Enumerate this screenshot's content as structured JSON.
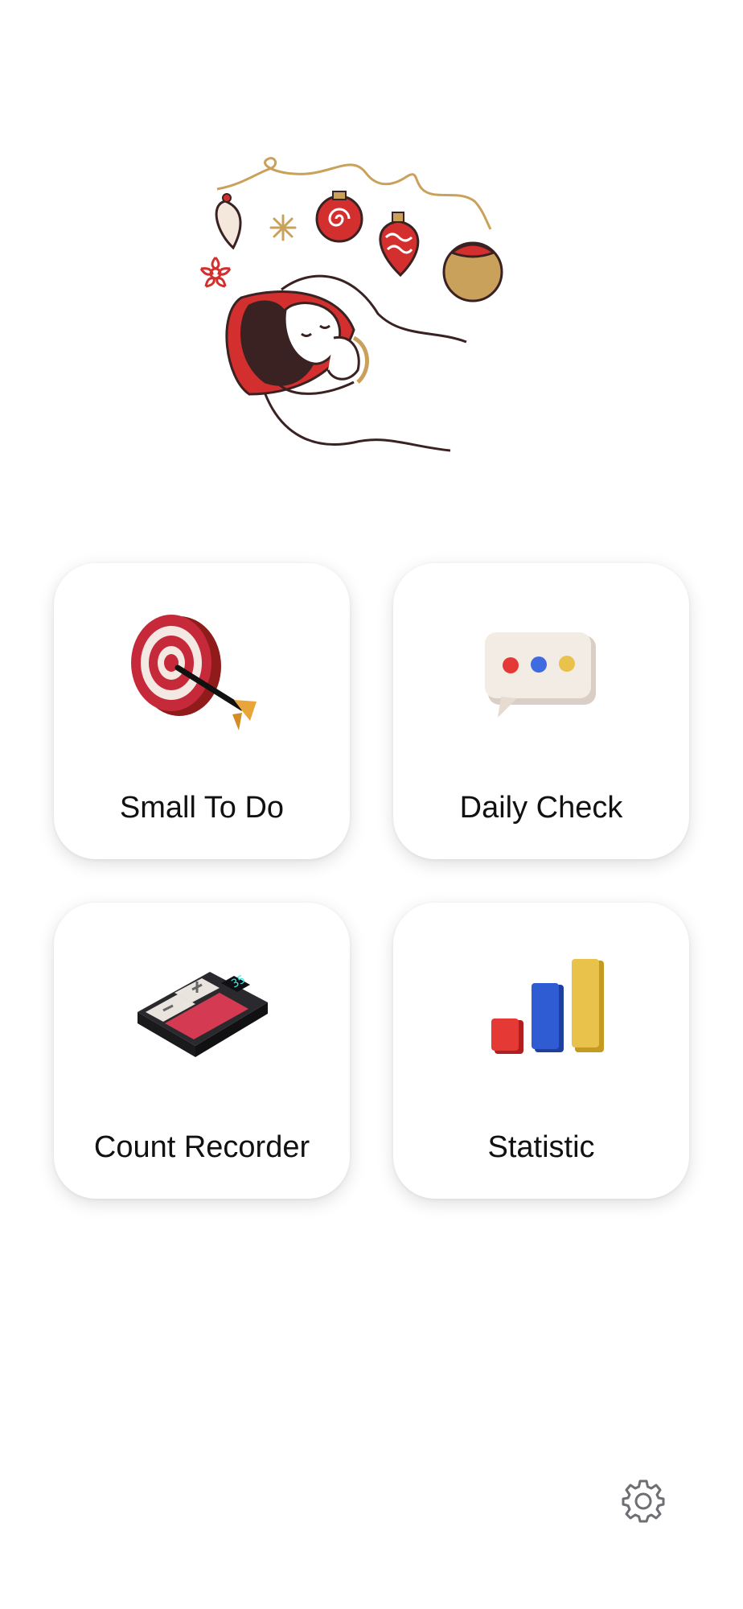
{
  "hero": {
    "illustration": "sleeping-person-with-christmas-ornaments"
  },
  "cards": [
    {
      "label": "Small To Do",
      "icon": "target-dart-icon"
    },
    {
      "label": "Daily Check",
      "icon": "chat-bubble-icon"
    },
    {
      "label": "Count Recorder",
      "icon": "calculator-icon"
    },
    {
      "label": "Statistic",
      "icon": "bar-chart-icon"
    }
  ],
  "settings": {
    "icon": "gear-icon"
  },
  "colors": {
    "red": "#d32f2f",
    "gold": "#c9a15b",
    "blue": "#2f5bd3",
    "yellow": "#e8c24a",
    "ink": "#3a2222"
  }
}
